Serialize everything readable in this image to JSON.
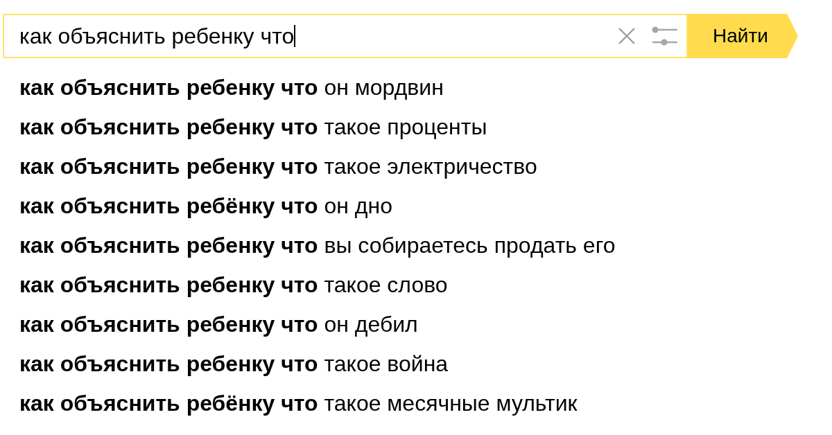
{
  "search": {
    "value": "как объяснить ребенку что",
    "focused": true
  },
  "search_button": {
    "label": "Найти"
  },
  "suggestions": [
    "**как объяснить ребенку что** он мордвин",
    "**как объяснить ребенку что** такое проценты",
    "**как объяснить ребенку что** такое электричество",
    "**как объяснить ребёнку что** он дно",
    "**как объяснить ребенку что** вы собираетесь продать его",
    "**как объяснить ребенку что** такое слово",
    "**как объяснить ребенку что** он дебил",
    "**как объяснить ребенку что** такое война",
    "**как объяснить ребёнку что** такое месячные мультик"
  ]
}
